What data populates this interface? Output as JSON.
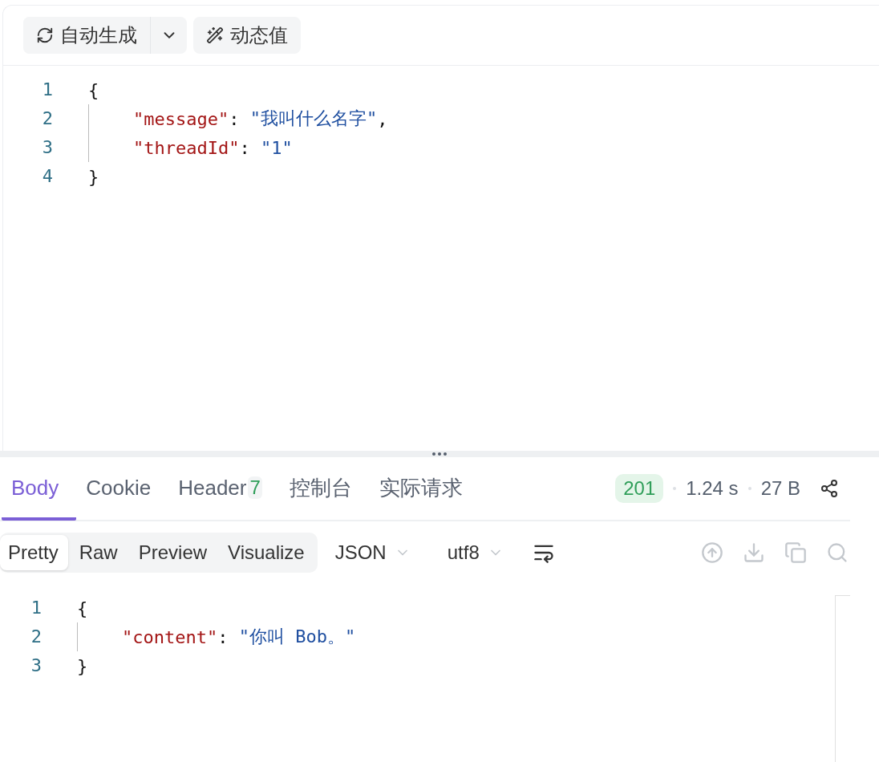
{
  "request_toolbar": {
    "generate_button": {
      "label": "自动生成"
    },
    "dynamic_button": {
      "label": "动态值"
    }
  },
  "request_body": {
    "lines": [
      {
        "number": "1",
        "indented": false,
        "tokens": [
          {
            "kind": "punct",
            "text": "{"
          }
        ]
      },
      {
        "number": "2",
        "indented": true,
        "tokens": [
          {
            "kind": "key",
            "text": "\"message\""
          },
          {
            "kind": "punct",
            "text": ": "
          },
          {
            "kind": "string",
            "text": "\"我叫什么名字\""
          },
          {
            "kind": "punct",
            "text": ","
          }
        ]
      },
      {
        "number": "3",
        "indented": true,
        "tokens": [
          {
            "kind": "key",
            "text": "\"threadId\""
          },
          {
            "kind": "punct",
            "text": ": "
          },
          {
            "kind": "string",
            "text": "\"1\""
          }
        ]
      },
      {
        "number": "4",
        "indented": false,
        "tokens": [
          {
            "kind": "punct",
            "text": "}"
          }
        ]
      }
    ]
  },
  "response_tabs": [
    {
      "label": "Body",
      "selected": true
    },
    {
      "label": "Cookie",
      "selected": false
    },
    {
      "label": "Header",
      "badge": "7",
      "selected": false
    },
    {
      "label": "控制台",
      "selected": false
    },
    {
      "label": "实际请求",
      "selected": false
    }
  ],
  "response_status": {
    "code": "201",
    "time": "1.24 s",
    "size": "27 B"
  },
  "view_modes": [
    {
      "label": "Pretty",
      "selected": true
    },
    {
      "label": "Raw",
      "selected": false
    },
    {
      "label": "Preview",
      "selected": false
    },
    {
      "label": "Visualize",
      "selected": false
    }
  ],
  "format_select": {
    "value": "JSON"
  },
  "encoding_select": {
    "value": "utf8"
  },
  "response_body": {
    "lines": [
      {
        "number": "1",
        "indented": false,
        "tokens": [
          {
            "kind": "punct",
            "text": "{"
          }
        ]
      },
      {
        "number": "2",
        "indented": true,
        "tokens": [
          {
            "kind": "key",
            "text": "\"content\""
          },
          {
            "kind": "punct",
            "text": ": "
          },
          {
            "kind": "string",
            "text": "\"你叫 Bob。\""
          }
        ]
      },
      {
        "number": "3",
        "indented": false,
        "tokens": [
          {
            "kind": "punct",
            "text": "}"
          }
        ]
      }
    ]
  }
}
